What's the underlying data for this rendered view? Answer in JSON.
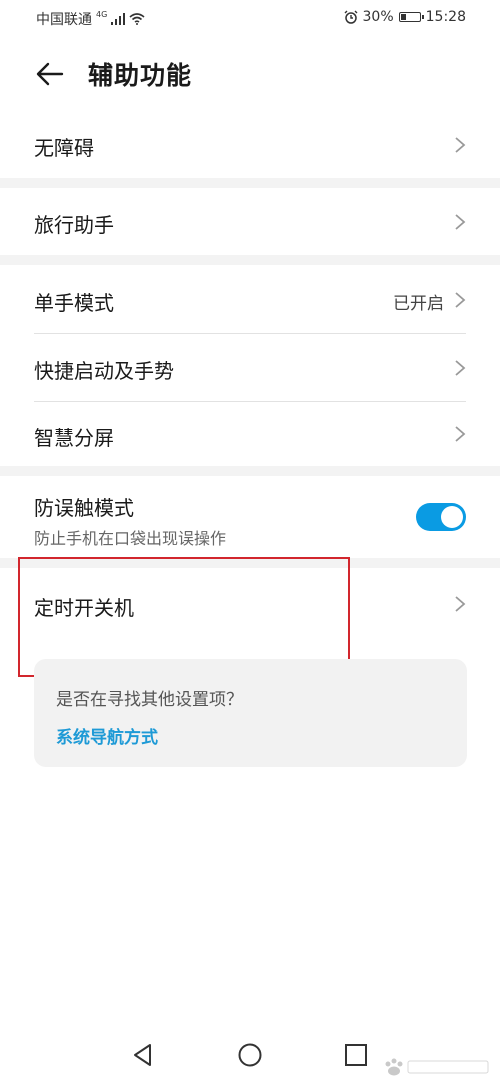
{
  "status": {
    "carrier": "中国联通",
    "network": "4G",
    "battery_percent": "30%",
    "battery_level": 0.3,
    "time": "15:28"
  },
  "header": {
    "title": "辅助功能"
  },
  "items": [
    {
      "label": "无障碍"
    },
    {
      "label": "旅行助手"
    },
    {
      "label": "单手模式",
      "value": "已开启"
    },
    {
      "label": "快捷启动及手势"
    },
    {
      "label": "智慧分屏"
    },
    {
      "label": "防误触模式",
      "subtitle": "防止手机在口袋出现误操作",
      "toggle_on": true
    },
    {
      "label": "定时开关机"
    }
  ],
  "suggestion": {
    "question": "是否在寻找其他设置项？",
    "link": "系统导航方式"
  },
  "colors": {
    "accent": "#0a9be3",
    "link": "#1e9ad6",
    "highlight": "#d2262d"
  }
}
